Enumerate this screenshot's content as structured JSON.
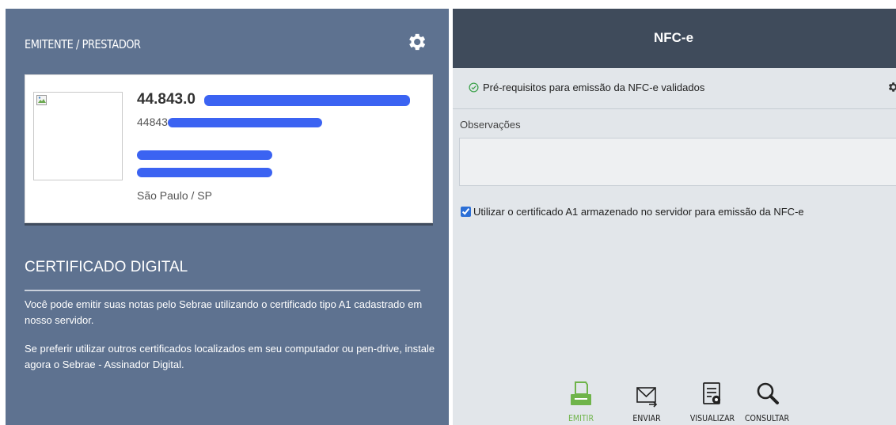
{
  "emitente": {
    "header_title": "EMITENTE / PRESTADOR",
    "settings_icon": "gear-icon",
    "cnpj_visible": "44.843.0",
    "ie_visible": "44843",
    "city": "São Paulo / SP",
    "logo_icon": "broken-image-icon",
    "redaction_color": "#3b63f2"
  },
  "certificado": {
    "title": "CERTIFICADO DIGITAL",
    "paragraph_1": "Você pode emitir suas notas pelo Sebrae utilizando o certificado tipo A1 cadastrado em nosso servidor.",
    "paragraph_2": "Se preferir utilizar outros certificados localizados em seu computador ou pen-drive, instale agora o Sebrae - Assinador Digital."
  },
  "nfce": {
    "title": "NFC-e",
    "prereq_text": "Pré-requisitos para emissão da NFC-e validados",
    "prereq_icon": "check-circle-icon",
    "settings_icon": "gear-icon",
    "observacoes_label": "Observações",
    "observacoes_value": "",
    "use_a1_label": "Utilizar o certificado A1 armazenado no servidor para emissão da NFC-e",
    "use_a1_checked": true
  },
  "actions": [
    {
      "label": "EMITIR",
      "icon": "printer-icon",
      "active": true
    },
    {
      "label": "ENVIAR",
      "icon": "envelope-icon",
      "active": false
    },
    {
      "label": "VISUALIZAR",
      "icon": "document-view-icon",
      "active": false
    },
    {
      "label": "CONSULTAR",
      "icon": "magnifier-icon",
      "active": false
    }
  ],
  "colors": {
    "left_panel_bg": "#5e7290",
    "right_header_bg": "#3f4b5b",
    "right_panel_bg": "#e2e6ea",
    "active_action": "#6fb44a",
    "check_green": "#3fa34d"
  }
}
